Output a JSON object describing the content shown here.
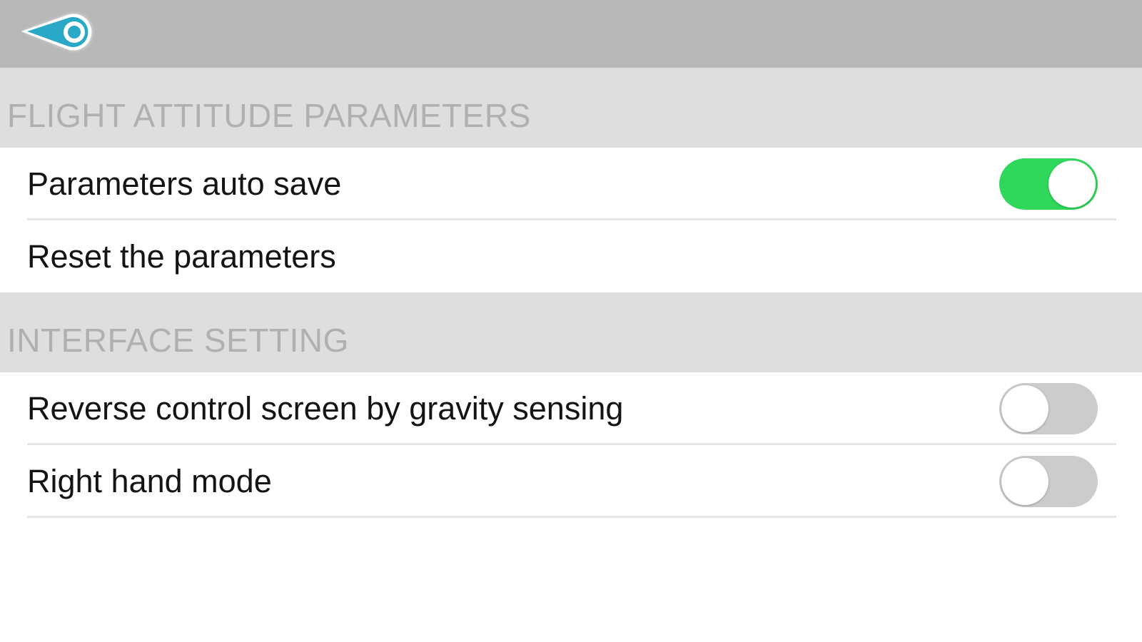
{
  "header": {
    "back_icon": "back-arrow-eye-icon",
    "accent_color": "#29a8c8"
  },
  "sections": [
    {
      "title": "FLIGHT ATTITUDE PARAMETERS",
      "items": [
        {
          "label": "Parameters auto save",
          "toggle": "on"
        },
        {
          "label": "Reset the parameters"
        }
      ]
    },
    {
      "title": "INTERFACE SETTING",
      "items": [
        {
          "label": "Reverse control screen by gravity sensing",
          "toggle": "off"
        },
        {
          "label": "Right hand mode",
          "toggle": "off"
        }
      ]
    }
  ],
  "colors": {
    "toggle_on": "#2fd85a",
    "toggle_off": "#cccccc",
    "topbar": "#b8b8b8",
    "section_header_bg": "#dedede",
    "section_header_text": "#b0b0b0"
  }
}
